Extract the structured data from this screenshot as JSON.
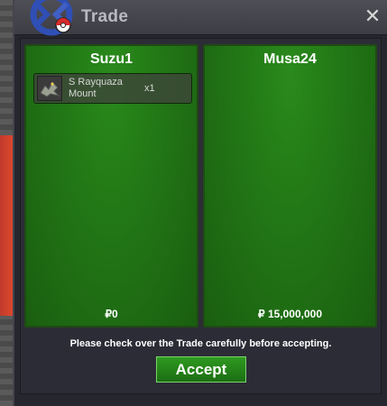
{
  "window": {
    "title": "Trade"
  },
  "trade": {
    "left": {
      "name": "Suzu1",
      "money": "0",
      "items": [
        {
          "name": "S Rayquaza Mount",
          "qty": "x1"
        }
      ]
    },
    "right": {
      "name": "Musa24",
      "money": "15,000,000"
    },
    "currency_symbol": "₽"
  },
  "footer": {
    "notice": "Please check over the Trade carefully before accepting.",
    "accept_label": "Accept"
  },
  "icons": {
    "logo": "pokeball-logo-icon",
    "close": "close-icon",
    "item": "rayquaza-mount-icon"
  },
  "colors": {
    "panel_green": "#237a16",
    "button_green": "#2e9a20"
  }
}
